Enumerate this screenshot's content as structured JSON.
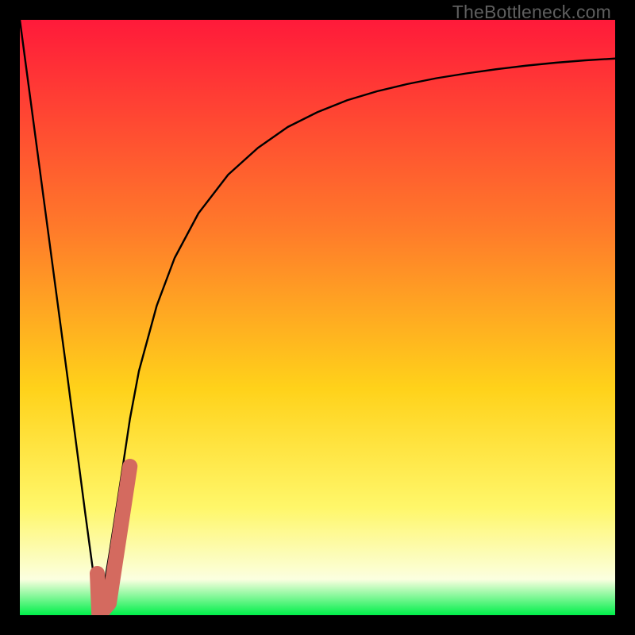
{
  "watermark": "TheBottleneck.com",
  "colors": {
    "frame": "#000000",
    "gradient_top": "#ff1a3a",
    "gradient_mid1": "#ff7a2a",
    "gradient_mid2": "#ffd21a",
    "gradient_mid3": "#fff76a",
    "gradient_pale": "#fbffe0",
    "gradient_bottom": "#00ef4a",
    "curve": "#000000",
    "marker": "#d46a5f"
  },
  "chart_data": {
    "type": "line",
    "title": "",
    "xlabel": "",
    "ylabel": "",
    "xlim": [
      0,
      100
    ],
    "ylim": [
      0,
      100
    ],
    "series": [
      {
        "name": "bottleneck-curve",
        "x": [
          0,
          4,
          8,
          11,
          13.3,
          15,
          17,
          18.5,
          20,
          23,
          26,
          30,
          35,
          40,
          45,
          50,
          55,
          60,
          65,
          70,
          75,
          80,
          85,
          90,
          95,
          100
        ],
        "values": [
          100,
          70,
          40,
          17,
          0,
          10,
          23,
          33,
          41,
          52,
          60,
          67.5,
          74,
          78.5,
          82,
          84.5,
          86.5,
          88,
          89.2,
          90.2,
          91,
          91.7,
          92.3,
          92.8,
          93.2,
          93.5
        ]
      }
    ],
    "marker": {
      "name": "highlight-j",
      "points": [
        {
          "x": 13.0,
          "y": 7.0
        },
        {
          "x": 13.3,
          "y": 0.0
        },
        {
          "x": 15.0,
          "y": 2.0
        },
        {
          "x": 18.5,
          "y": 25.0
        }
      ]
    }
  }
}
